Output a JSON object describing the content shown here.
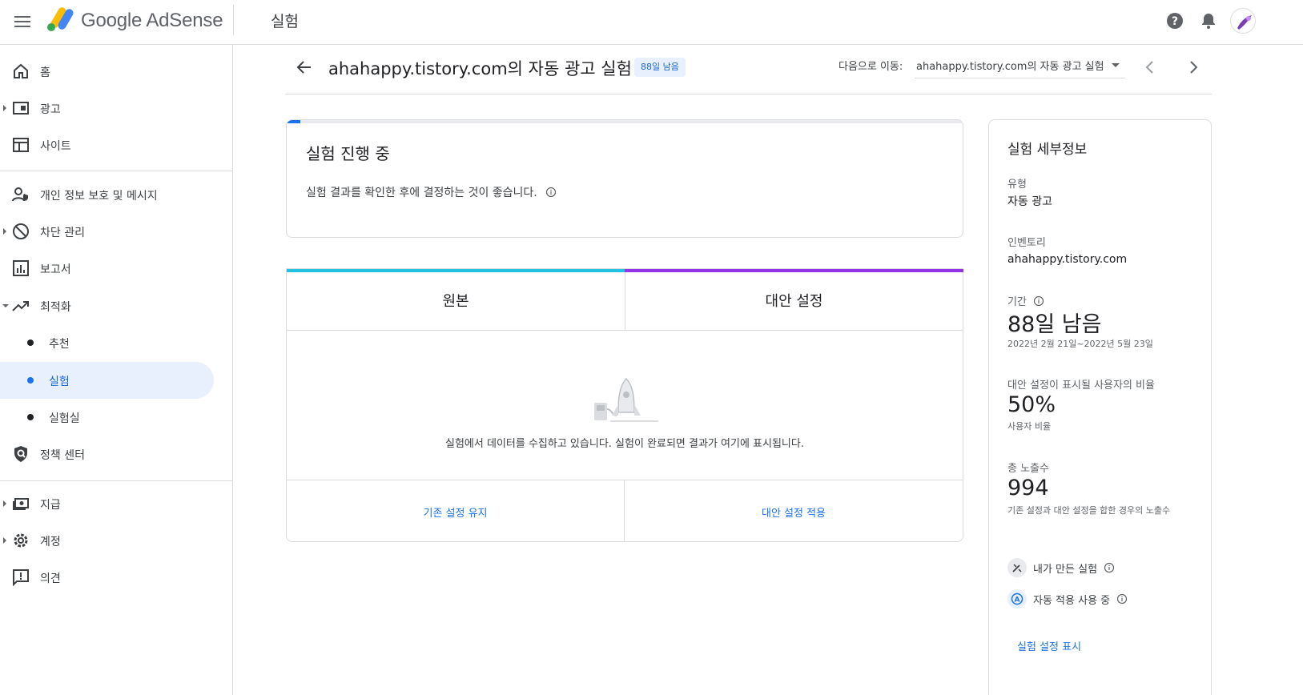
{
  "topbar": {
    "brand": "Google AdSense",
    "page_title": "실험",
    "icons": [
      "menu-icon",
      "adsense-logo-icon",
      "help-icon",
      "bell-icon",
      "avatar"
    ]
  },
  "sidebar": {
    "items": [
      {
        "label": "홈",
        "icon": "home-icon"
      },
      {
        "label": "광고",
        "icon": "ads-icon"
      },
      {
        "label": "사이트",
        "icon": "sites-icon"
      },
      {
        "label": "개인 정보 보호 및 메시지",
        "icon": "privacy-icon"
      },
      {
        "label": "차단 관리",
        "icon": "block-icon"
      },
      {
        "label": "보고서",
        "icon": "reports-icon"
      },
      {
        "label": "최적화",
        "icon": "trending-icon"
      },
      {
        "label": "추천"
      },
      {
        "label": "실험"
      },
      {
        "label": "실험실"
      },
      {
        "label": "정책 센터",
        "icon": "policy-icon"
      },
      {
        "label": "지급",
        "icon": "payments-icon"
      },
      {
        "label": "계정",
        "icon": "settings-icon"
      },
      {
        "label": "의견",
        "icon": "feedback-icon"
      }
    ]
  },
  "header": {
    "title": "ahahappy.tistory.com의 자동 광고 실험",
    "chip": "88일 남음",
    "goto_label": "다음으로 이동:",
    "goto_value": "ahahappy.tistory.com의 자동 광고 실험"
  },
  "status": {
    "heading": "실험 진행 중",
    "text": "실험 결과를 확인한 후에 결정하는 것이 좋습니다.",
    "progress": 0.02
  },
  "compare": {
    "original_label": "원본",
    "alternative_label": "대안 설정",
    "empty_text": "실험에서 데이터를 수집하고 있습니다. 실험이 완료되면 결과가 여기에 표시됩니다.",
    "keep_link": "기존 설정 유지",
    "apply_link": "대안 설정 적용",
    "colors": {
      "original": "#24c1e0",
      "alternative": "#9334e6",
      "link": "#1a73e8"
    }
  },
  "details": {
    "title": "실험 세부정보",
    "type_label": "유형",
    "type_value": "자동 광고",
    "inventory_label": "인벤토리",
    "inventory_value": "ahahappy.tistory.com",
    "period_label": "기간",
    "period_value": "88일 남음",
    "period_dates": "2022년 2월 21일~2022년 5월 23일",
    "ratio_label": "대안 설정이 표시될 사용자의 비율",
    "ratio_value": "50%",
    "ratio_sub": "사용자 비율",
    "impressions_label": "총 노출수",
    "impressions_value": "994",
    "impressions_sub": "기존 설정과 대안 설정을 합한 경우의 노출수",
    "created_by_me": "내가 만든 실험",
    "auto_apply": "자동 적용 사용 중",
    "show_settings_link": "실험 설정 표시"
  }
}
